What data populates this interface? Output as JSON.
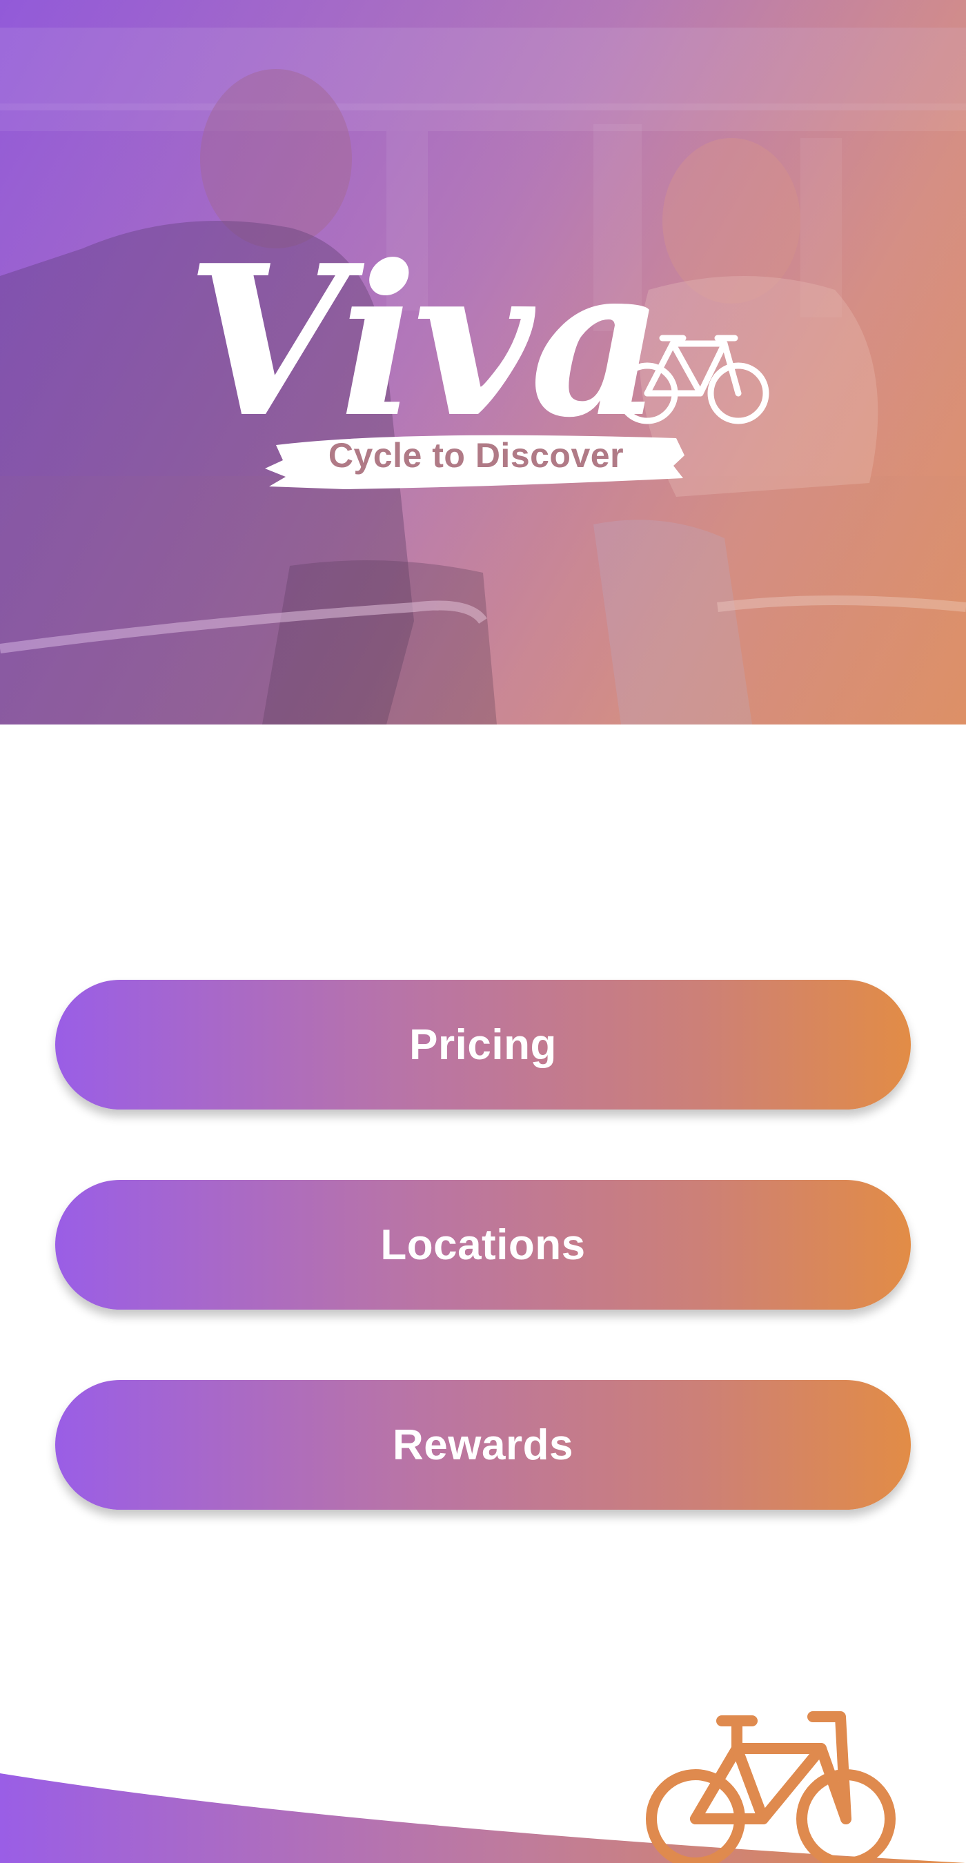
{
  "brand": {
    "name": "Viva",
    "tagline": "Cycle to Discover"
  },
  "hero": {
    "icon": "bicycle-icon"
  },
  "menu": {
    "items": [
      {
        "label": "Pricing"
      },
      {
        "label": "Locations"
      },
      {
        "label": "Rewards"
      }
    ]
  },
  "footer": {
    "icon": "bicycle-icon"
  },
  "colors": {
    "gradient_start": "#9a5ee6",
    "gradient_end": "#e28c46",
    "tagline": "#b07a86",
    "bike_icon": "#df8a4e"
  }
}
